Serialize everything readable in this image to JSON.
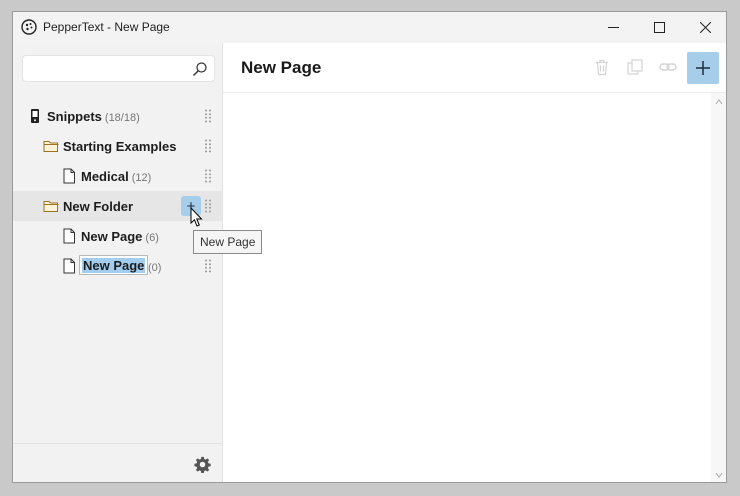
{
  "window": {
    "title": "PepperText - New Page",
    "minimize_icon": "minimize-icon",
    "maximize_icon": "maximize-icon",
    "close_icon": "close-icon"
  },
  "search": {
    "value": "",
    "placeholder": "",
    "icon": "search-icon"
  },
  "tree": {
    "root": {
      "label": "Snippets",
      "count": "(18/18)",
      "icon": "phone-icon"
    },
    "items": [
      {
        "label": "Starting Examples",
        "count": "",
        "icon": "folder-icon"
      },
      {
        "label": "Medical",
        "count": "(12)",
        "icon": "page-icon"
      },
      {
        "label": "New Folder",
        "count": "",
        "icon": "folder-icon"
      },
      {
        "label": "New Page",
        "count": "(6)",
        "icon": "page-icon"
      },
      {
        "label": "New Page",
        "count": "(0)",
        "icon": "page-icon"
      }
    ],
    "add_button_label": "+"
  },
  "tooltip": {
    "text": "New Page"
  },
  "main": {
    "title": "New Page",
    "toolbar": {
      "delete_icon": "trash-icon",
      "duplicate_icon": "copy-icon",
      "link_icon": "link-icon",
      "add_icon": "plus-icon"
    }
  },
  "footer": {
    "settings_icon": "gear-icon"
  },
  "colors": {
    "accent": "#a6cdea",
    "selection": "#a3cdee",
    "sidebar_bg": "#f2f2f2",
    "folder": "#b8862f"
  }
}
